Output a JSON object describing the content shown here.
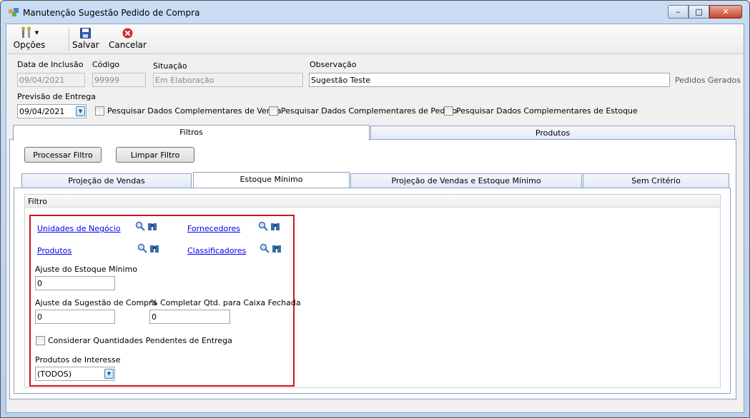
{
  "window": {
    "title": "Manutenção Sugestão Pedido de Compra",
    "controls": {
      "minimize": "–",
      "maximize": "□",
      "close": "✕"
    }
  },
  "toolbar": {
    "options_label": "Opções",
    "save_label": "Salvar",
    "cancel_label": "Cancelar"
  },
  "header": {
    "inclusion_date_label": "Data de Inclusão",
    "inclusion_date_value": "09/04/2021",
    "code_label": "Código",
    "code_value": "99999",
    "status_label": "Situação",
    "status_value": "Em Elaboração",
    "observation_label": "Observação",
    "observation_value": "Sugestão Teste",
    "generated_orders_label": "Pedidos Gerados",
    "delivery_label": "Previsão de Entrega",
    "delivery_value": "09/04/2021",
    "chk_sales": "Pesquisar Dados Complementares de Venda",
    "chk_order": "Pesquisar Dados Complementares de Pedido",
    "chk_stock": "Pesquisar Dados Complementares de Estoque"
  },
  "main_tabs": {
    "filters": "Filtros",
    "products": "Produtos"
  },
  "filter_buttons": {
    "process": "Processar Filtro",
    "clear": "Limpar Filtro"
  },
  "sub_tabs": {
    "sales": "Projeção de Vendas",
    "min_stock": "Estoque Mínimo",
    "sales_stock": "Projeção de Vendas e Estoque Mínimo",
    "none": "Sem Critério"
  },
  "filter": {
    "group_title": "Filtro",
    "business_units": "Unidades de Negócio",
    "suppliers": "Fornecedores",
    "products": "Produtos",
    "classifiers": "Classificadores",
    "min_stock_adj_label": "Ajuste do Estoque Mínimo",
    "min_stock_adj_value": "0",
    "suggestion_adj_label": "Ajuste da Sugestão de Compra",
    "suggestion_adj_value": "0",
    "complete_box_label": "% Completar Qtd. para Caixa Fechada",
    "complete_box_value": "0",
    "pending_delivery_label": "Considerar Quantidades Pendentes de Entrega",
    "interest_label": "Produtos de Interesse",
    "interest_value": "(TODOS)"
  },
  "colors": {
    "highlight_border": "#d0141c",
    "link": "#0000ee"
  }
}
